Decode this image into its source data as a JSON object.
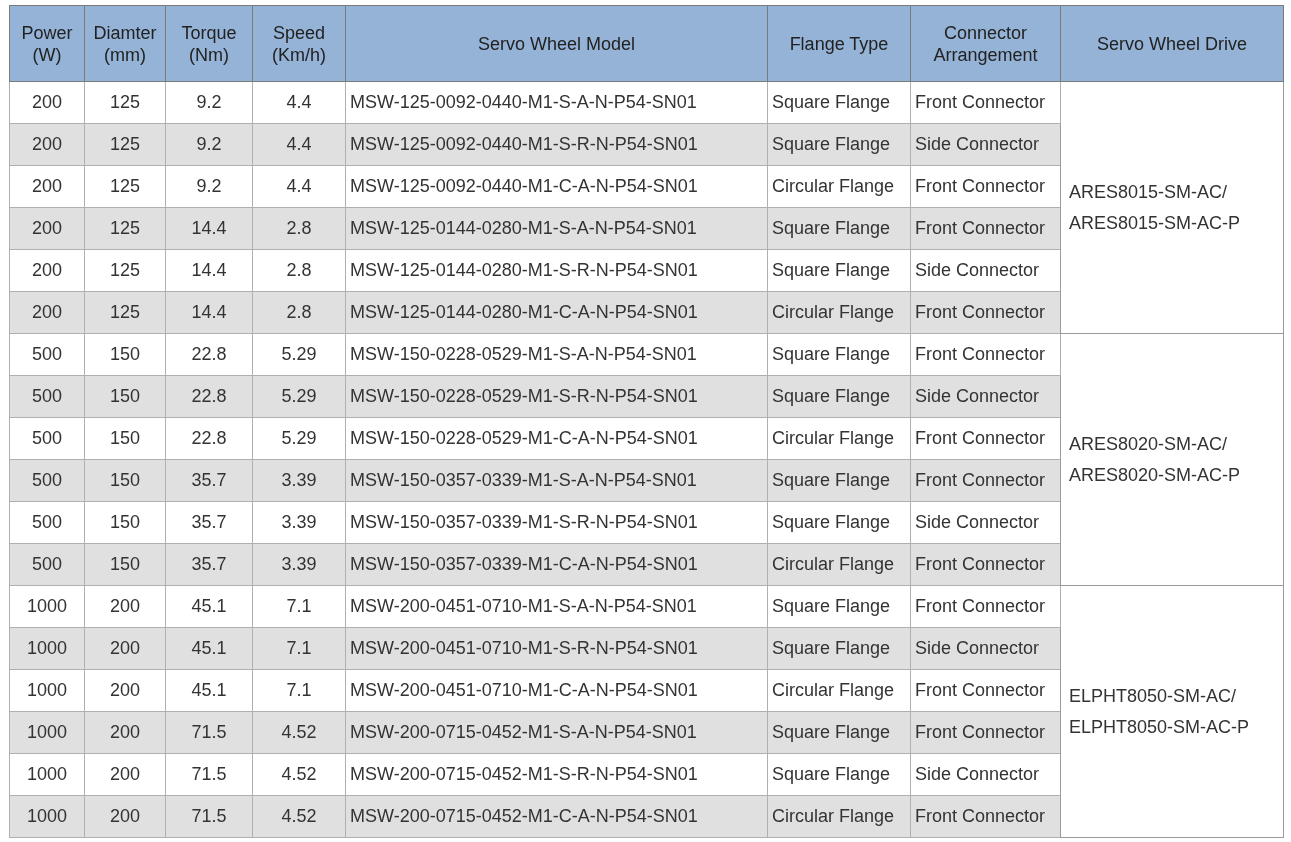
{
  "table": {
    "columns": [
      {
        "lines": [
          "Power",
          "(W)"
        ]
      },
      {
        "lines": [
          "Diamter",
          "(mm)"
        ]
      },
      {
        "lines": [
          "Torque",
          "(Nm)"
        ]
      },
      {
        "lines": [
          "Speed",
          "(Km/h)"
        ]
      },
      {
        "lines": [
          "Servo Wheel Model"
        ]
      },
      {
        "lines": [
          "Flange Type"
        ]
      },
      {
        "lines": [
          "Connector",
          "Arrangement"
        ]
      },
      {
        "lines": [
          "Servo Wheel Drive"
        ]
      }
    ],
    "groups": [
      {
        "drive": [
          "ARES8015-SM-AC/",
          "ARES8015-SM-AC-P"
        ],
        "rows": [
          [
            "200",
            "125",
            "9.2",
            "4.4",
            "MSW-125-0092-0440-M1-S-A-N-P54-SN01",
            "Square Flange",
            "Front Connector"
          ],
          [
            "200",
            "125",
            "9.2",
            "4.4",
            "MSW-125-0092-0440-M1-S-R-N-P54-SN01",
            "Square Flange",
            "Side Connector"
          ],
          [
            "200",
            "125",
            "9.2",
            "4.4",
            "MSW-125-0092-0440-M1-C-A-N-P54-SN01",
            "Circular Flange",
            "Front Connector"
          ],
          [
            "200",
            "125",
            "14.4",
            "2.8",
            "MSW-125-0144-0280-M1-S-A-N-P54-SN01",
            "Square Flange",
            "Front Connector"
          ],
          [
            "200",
            "125",
            "14.4",
            "2.8",
            "MSW-125-0144-0280-M1-S-R-N-P54-SN01",
            "Square Flange",
            "Side Connector"
          ],
          [
            "200",
            "125",
            "14.4",
            "2.8",
            "MSW-125-0144-0280-M1-C-A-N-P54-SN01",
            "Circular Flange",
            "Front Connector"
          ]
        ]
      },
      {
        "drive": [
          "ARES8020-SM-AC/",
          "ARES8020-SM-AC-P"
        ],
        "rows": [
          [
            "500",
            "150",
            "22.8",
            "5.29",
            "MSW-150-0228-0529-M1-S-A-N-P54-SN01",
            "Square Flange",
            "Front Connector"
          ],
          [
            "500",
            "150",
            "22.8",
            "5.29",
            "MSW-150-0228-0529-M1-S-R-N-P54-SN01",
            "Square Flange",
            "Side Connector"
          ],
          [
            "500",
            "150",
            "22.8",
            "5.29",
            "MSW-150-0228-0529-M1-C-A-N-P54-SN01",
            "Circular Flange",
            "Front Connector"
          ],
          [
            "500",
            "150",
            "35.7",
            "3.39",
            "MSW-150-0357-0339-M1-S-A-N-P54-SN01",
            "Square Flange",
            "Front Connector"
          ],
          [
            "500",
            "150",
            "35.7",
            "3.39",
            "MSW-150-0357-0339-M1-S-R-N-P54-SN01",
            "Square Flange",
            "Side Connector"
          ],
          [
            "500",
            "150",
            "35.7",
            "3.39",
            "MSW-150-0357-0339-M1-C-A-N-P54-SN01",
            "Circular Flange",
            "Front Connector"
          ]
        ]
      },
      {
        "drive": [
          "ELPHT8050-SM-AC/",
          "ELPHT8050-SM-AC-P"
        ],
        "rows": [
          [
            "1000",
            "200",
            "45.1",
            "7.1",
            "MSW-200-0451-0710-M1-S-A-N-P54-SN01",
            "Square Flange",
            "Front Connector"
          ],
          [
            "1000",
            "200",
            "45.1",
            "7.1",
            "MSW-200-0451-0710-M1-S-R-N-P54-SN01",
            "Square Flange",
            "Side Connector"
          ],
          [
            "1000",
            "200",
            "45.1",
            "7.1",
            "MSW-200-0451-0710-M1-C-A-N-P54-SN01",
            "Circular Flange",
            "Front Connector"
          ],
          [
            "1000",
            "200",
            "71.5",
            "4.52",
            "MSW-200-0715-0452-M1-S-A-N-P54-SN01",
            "Square Flange",
            "Front Connector"
          ],
          [
            "1000",
            "200",
            "71.5",
            "4.52",
            "MSW-200-0715-0452-M1-S-R-N-P54-SN01",
            "Square Flange",
            "Side Connector"
          ],
          [
            "1000",
            "200",
            "71.5",
            "4.52",
            "MSW-200-0715-0452-M1-C-A-N-P54-SN01",
            "Circular Flange",
            "Front Connector"
          ]
        ]
      }
    ]
  }
}
